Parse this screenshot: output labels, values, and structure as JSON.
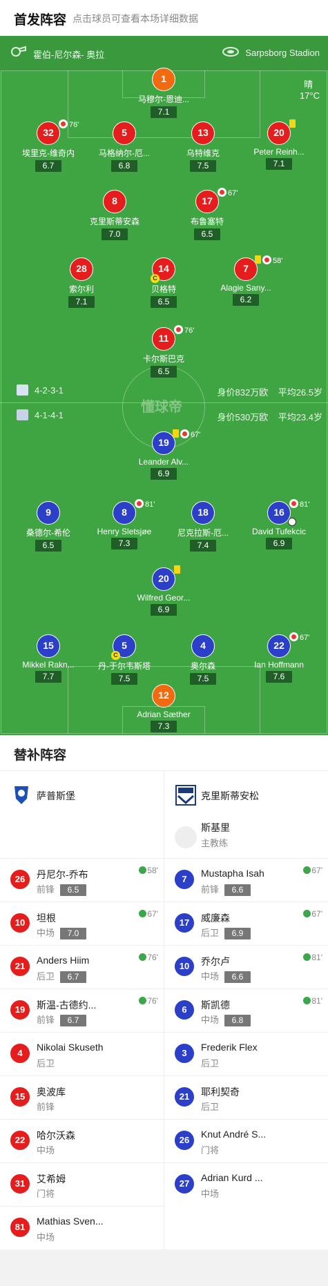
{
  "header": {
    "title": "首发阵容",
    "subtitle": "点击球员可查看本场详细数据"
  },
  "match": {
    "referee": "霍伯-尼尔森- 奥拉",
    "stadium": "Sarpsborg Stadion",
    "weather": "晴",
    "temperature": "17°C"
  },
  "watermark": "懂球帝",
  "home": {
    "formation": "4-2-3-1",
    "value": "身价832万欧",
    "avg_age": "平均26.5岁",
    "players": [
      {
        "num": "1",
        "name": "马穆尔-恩迪...",
        "rating": "7.1"
      },
      {
        "num": "32",
        "name": "埃里克-维奇内",
        "rating": "6.7",
        "sub": "76'"
      },
      {
        "num": "5",
        "name": "马格纳尔-厄...",
        "rating": "6.8"
      },
      {
        "num": "13",
        "name": "乌特维克",
        "rating": "7.5"
      },
      {
        "num": "20",
        "name": "Peter Reinh...",
        "rating": "7.1"
      },
      {
        "num": "8",
        "name": "克里斯蒂安森",
        "rating": "7.0"
      },
      {
        "num": "17",
        "name": "布鲁塞特",
        "rating": "6.5",
        "sub": "67'"
      },
      {
        "num": "28",
        "name": "索尔利",
        "rating": "7.1"
      },
      {
        "num": "14",
        "name": "贝格特",
        "rating": "6.5",
        "captain": "C"
      },
      {
        "num": "7",
        "name": "Alagie Sany...",
        "rating": "6.2",
        "sub": "58'"
      },
      {
        "num": "11",
        "name": "卡尔斯巴克",
        "rating": "6.5",
        "sub": "76'"
      }
    ]
  },
  "away": {
    "formation": "4-1-4-1",
    "value": "身价530万欧",
    "avg_age": "平均23.4岁",
    "players": [
      {
        "num": "19",
        "name": "Leander Alv...",
        "rating": "6.9",
        "sub": "67'"
      },
      {
        "num": "9",
        "name": "桑德尔-希伦",
        "rating": "6.5"
      },
      {
        "num": "8",
        "name": "Henry Sletsjøe",
        "rating": "7.3",
        "sub": "81'"
      },
      {
        "num": "18",
        "name": "尼克拉斯-厄...",
        "rating": "7.4"
      },
      {
        "num": "16",
        "name": "David Tufekcic",
        "rating": "6.9",
        "sub": "81'"
      },
      {
        "num": "20",
        "name": "Wilfred Geor...",
        "rating": "6.9"
      },
      {
        "num": "15",
        "name": "Mikkel Rakn...",
        "rating": "7.7"
      },
      {
        "num": "5",
        "name": "丹-于尔韦斯塔",
        "rating": "7.5",
        "captain": "C"
      },
      {
        "num": "4",
        "name": "奥尔森",
        "rating": "7.5"
      },
      {
        "num": "22",
        "name": "Ian Hoffmann",
        "rating": "7.6",
        "sub": "67'"
      },
      {
        "num": "12",
        "name": "Adrian Sæther",
        "rating": "7.3"
      }
    ]
  },
  "subs": {
    "title": "替补阵容",
    "left": {
      "team": "萨普斯堡",
      "players": [
        {
          "num": "26",
          "name": "丹尼尔-乔布",
          "pos": "前锋",
          "rating": "6.5",
          "in": "58'"
        },
        {
          "num": "10",
          "name": "坦根",
          "pos": "中场",
          "rating": "7.0",
          "in": "67'"
        },
        {
          "num": "21",
          "name": "Anders Hiim",
          "pos": "后卫",
          "rating": "6.7",
          "in": "76'"
        },
        {
          "num": "19",
          "name": "斯温-古德约...",
          "pos": "前锋",
          "rating": "6.7",
          "in": "76'"
        },
        {
          "num": "4",
          "name": "Nikolai Skuseth",
          "pos": "后卫"
        },
        {
          "num": "15",
          "name": "奥波库",
          "pos": "前锋"
        },
        {
          "num": "22",
          "name": "哈尔沃森",
          "pos": "中场"
        },
        {
          "num": "31",
          "name": "艾希姆",
          "pos": "门将"
        },
        {
          "num": "81",
          "name": "Mathias Sven...",
          "pos": "中场"
        }
      ]
    },
    "right": {
      "team": "克里斯蒂安松",
      "coach": "斯基里",
      "coach_role": "主教练",
      "players": [
        {
          "num": "7",
          "name": "Mustapha Isah",
          "pos": "前锋",
          "rating": "6.6",
          "in": "67'"
        },
        {
          "num": "17",
          "name": "威廉森",
          "pos": "后卫",
          "rating": "6.9",
          "in": "67'"
        },
        {
          "num": "10",
          "name": "乔尔卢",
          "pos": "中场",
          "rating": "6.6",
          "in": "81'"
        },
        {
          "num": "6",
          "name": "斯凯德",
          "pos": "中场",
          "rating": "6.8",
          "in": "81'"
        },
        {
          "num": "3",
          "name": "Frederik Flex",
          "pos": "后卫"
        },
        {
          "num": "21",
          "name": "耶利契奇",
          "pos": "后卫"
        },
        {
          "num": "26",
          "name": "Knut André S...",
          "pos": "门将"
        },
        {
          "num": "27",
          "name": "Adrian Kurd ...",
          "pos": "中场"
        }
      ]
    }
  },
  "colors": {
    "pitch": "#3fa542",
    "home": "#e51d1d",
    "away": "#2b3fc9",
    "goalkeeper": "#f26a10"
  }
}
